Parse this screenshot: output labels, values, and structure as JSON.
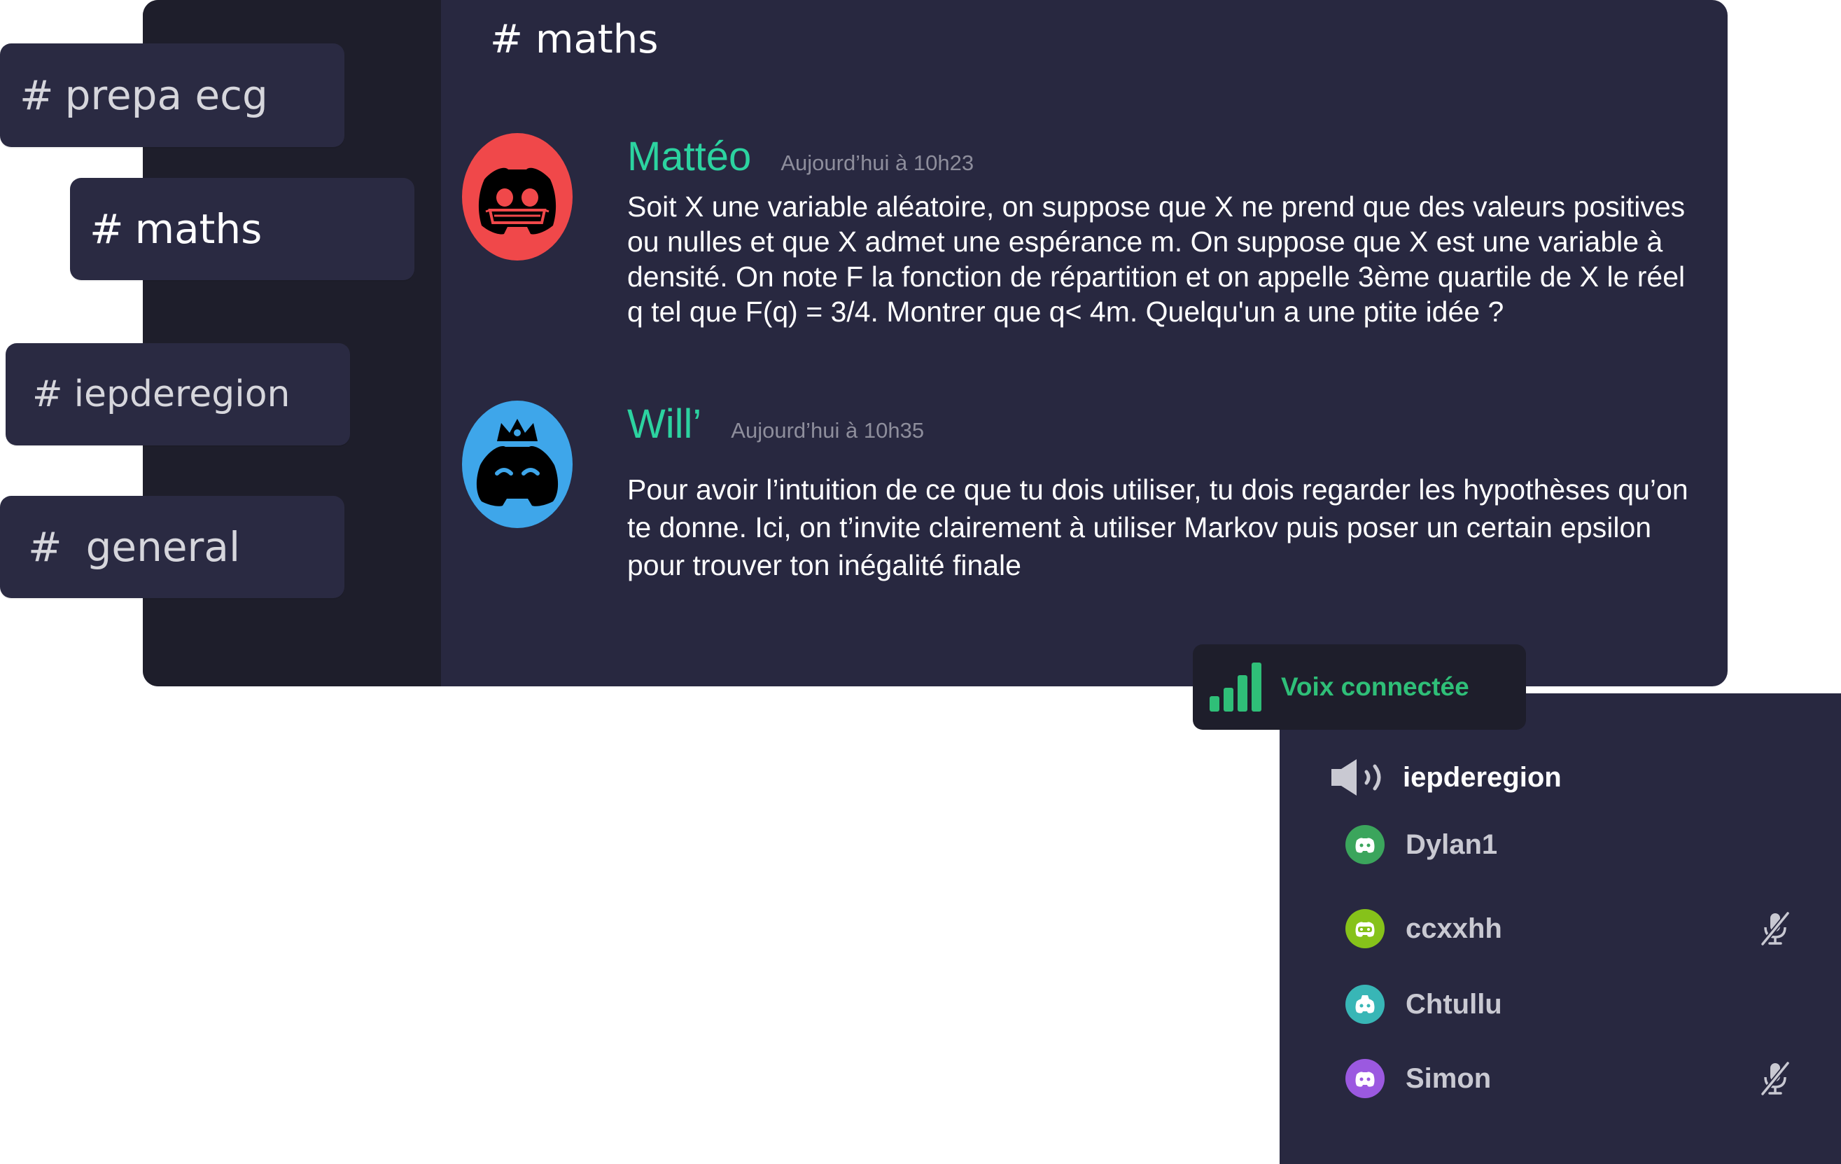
{
  "sidebar": {
    "channels": [
      {
        "hash": "#",
        "name": "prepa ecg"
      },
      {
        "hash": "#",
        "name": "maths"
      },
      {
        "hash": "#",
        "name": "iepderegion"
      },
      {
        "hash": "#",
        "name": "general"
      }
    ]
  },
  "header": {
    "hash": "#",
    "channel": "maths"
  },
  "messages": [
    {
      "author": "Mattéo",
      "timestamp": "Aujourd’hui à 10h23",
      "avatar_color": "#f0484a",
      "text": "Soit X une variable aléatoire, on suppose que X ne prend que des valeurs positives ou nulles et que X admet une espérance m. On suppose que X est une variable à densité. On note F la fonction de répartition et on appelle 3ème quartile de X le réel q tel que F(q) = 3/4. Montrer que q< 4m. Quelqu'un a une ptite idée ?"
    },
    {
      "author": "Will’",
      "timestamp": "Aujourd’hui à 10h35",
      "avatar_color": "#3ea6ea",
      "text": "Pour avoir l’intuition de ce que tu dois utiliser, tu dois regarder les hypothèses qu’on te donne. Ici, on t’invite clairement à utiliser Markov puis poser un certain epsilon pour trouver ton inégalité finale"
    }
  ],
  "voice": {
    "status": "Voix connectée",
    "status_color": "#2fbf78",
    "channel": "iepderegion",
    "users": [
      {
        "name": "Dylan1",
        "avatar_color": "#3ba55c",
        "muted": false
      },
      {
        "name": "ccxxhh",
        "avatar_color": "#86c21a",
        "muted": true
      },
      {
        "name": "Chtullu",
        "avatar_color": "#38b6b6",
        "muted": false
      },
      {
        "name": "Simon",
        "avatar_color": "#9b59e0",
        "muted": true
      }
    ]
  },
  "colors": {
    "window_bg": "#282840",
    "sidebar_bg": "#1e1e2b",
    "author_color": "#2cd3a0"
  }
}
